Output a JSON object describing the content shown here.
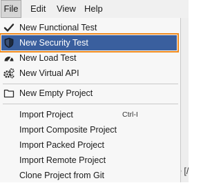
{
  "menubar": {
    "items": [
      {
        "label": "File"
      },
      {
        "label": "Edit"
      },
      {
        "label": "View"
      },
      {
        "label": "Help"
      }
    ]
  },
  "file_menu": {
    "items": [
      {
        "label": "New Functional Test",
        "icon": "checkmark-icon"
      },
      {
        "label": "New Security Test",
        "icon": "shield-icon",
        "state": "highlighted"
      },
      {
        "label": "New Load Test",
        "icon": "gauge-icon"
      },
      {
        "label": "New Virtual API",
        "icon": "gears-icon"
      },
      {
        "label": "New Empty Project",
        "icon": "folder-icon"
      },
      {
        "label": "Import Project",
        "shortcut": "Ctrl-I"
      },
      {
        "label": "Import Composite Project"
      },
      {
        "label": "Import Packed Project"
      },
      {
        "label": "Import Remote Project"
      },
      {
        "label": "Clone Project from Git"
      }
    ]
  },
  "background": {
    "partial_text": "e [/"
  },
  "colors": {
    "highlight": "#3a5f9e",
    "highlight_outline": "#f08a1c"
  }
}
